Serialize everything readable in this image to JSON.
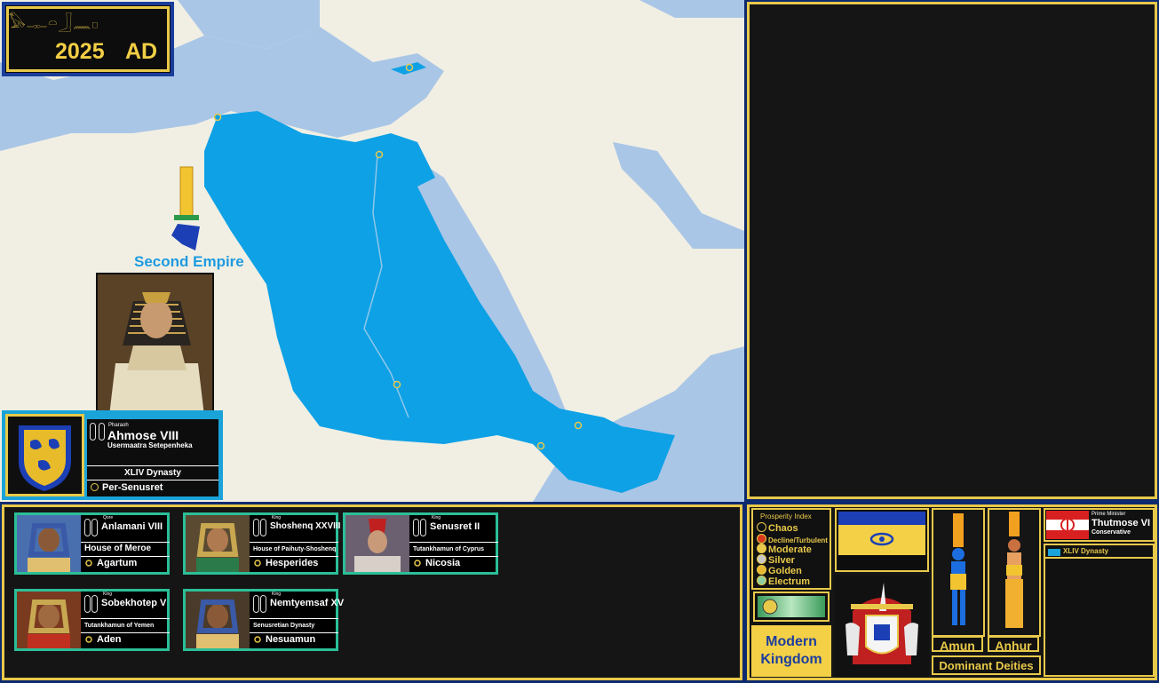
{
  "header": {
    "glyphs": "𓅃𓊃𓏏𓃀𓈖𓊪",
    "year": "2025",
    "era": "AD"
  },
  "map": {
    "empire_label": "Second Empire",
    "colors": {
      "sea": "#aac6e6",
      "land": "#f1efe4",
      "empire": "#0ea1e6"
    }
  },
  "ruler": {
    "title": "Pharaoh",
    "name": "Ahmose VIII",
    "throne_name": "Usermaatra Setepenheka",
    "dynasty": "XLIV Dynasty",
    "capital": "Per-Senusret"
  },
  "vassals": [
    {
      "title": "Qore",
      "name": "Anlamani VIII",
      "house": "House of Meroe",
      "city": "Agartum"
    },
    {
      "title": "King",
      "name": "Shoshenq XXVIII",
      "house": "House of Paihuty-Shoshenq",
      "city": "Hesperides"
    },
    {
      "title": "King",
      "name": "Senusret II",
      "house": "Tutankhamun of Cyprus",
      "city": "Nicosia"
    },
    {
      "title": "King",
      "name": "Sobekhotep V",
      "house": "Tutankhamun of Yemen",
      "city": "Aden"
    },
    {
      "title": "King",
      "name": "Nemtyemsaf XV",
      "house": "Senusretian Dynasty",
      "city": "Nesuamun"
    }
  ],
  "prosperity": {
    "title": "Prosperity Index",
    "levels": [
      "Chaos",
      "Decline/Turbulent",
      "Moderate",
      "Silver",
      "Golden",
      "Electrum"
    ],
    "colors": [
      "#111111",
      "#d83a1a",
      "#e8c94a",
      "#c8c8c8",
      "#e8b830",
      "#8fd0a0"
    ]
  },
  "kingdom": {
    "line1": "Modern",
    "line2": "Kingdom"
  },
  "deities": {
    "amun": "Amun",
    "anhur": "Anhur",
    "label": "Dominant Deities"
  },
  "government": {
    "pm_title": "Prime Minister",
    "pm_name": "Thutmose VI",
    "pm_party": "Conservative",
    "party": "XLIV Dynasty"
  }
}
